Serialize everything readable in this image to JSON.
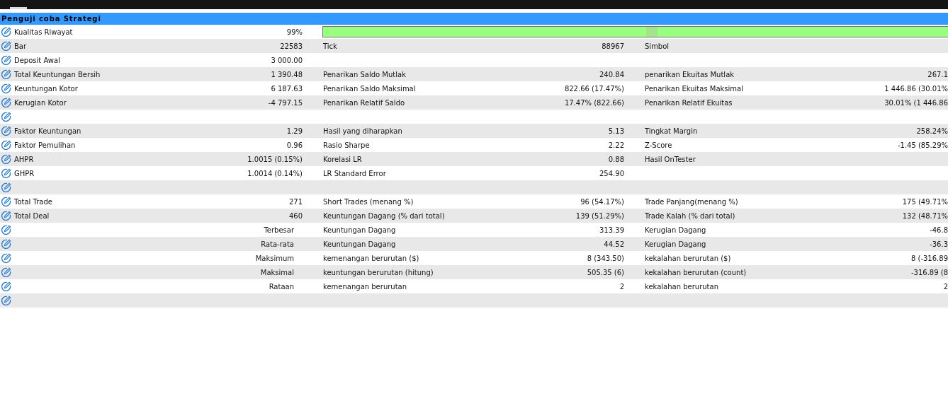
{
  "window": {
    "title": "Penguji coba Strategi"
  },
  "rows": [
    {
      "kind": "quality",
      "cells": [
        {
          "label": "Kualitas Riwayat",
          "value": "99%"
        }
      ],
      "progress": {
        "level": 1
      }
    },
    {
      "kind": "stat",
      "cells": [
        {
          "label": "Bar",
          "value": "22583"
        },
        {
          "label": "Tick",
          "value": "88967"
        },
        {
          "label": "Simbol"
        }
      ]
    },
    {
      "kind": "stat",
      "cells": [
        {
          "label": "Deposit Awal",
          "value": "3 000.00"
        }
      ]
    },
    {
      "kind": "stat",
      "cells": [
        {
          "label": "Total Keuntungan Bersih",
          "value": "1 390.48"
        },
        {
          "label": "Penarikan Saldo Mutlak",
          "value": "240.84"
        },
        {
          "label": "penarikan Ekuitas Mutlak",
          "value": "267.1"
        }
      ]
    },
    {
      "kind": "stat",
      "cells": [
        {
          "label": "Keuntungan Kotor",
          "value": "6 187.63"
        },
        {
          "label": "Penarikan Saldo Maksimal",
          "value": "822.66 (17.47%)"
        },
        {
          "label": "Penarikan Ekuitas Maksimal",
          "value": "1 446.86 (30.01%"
        }
      ]
    },
    {
      "kind": "stat",
      "cells": [
        {
          "label": "Kerugian Kotor",
          "value": "-4 797.15"
        },
        {
          "label": "Penarikan Relatif Saldo",
          "value": "17.47% (822.66)"
        },
        {
          "label": "Penarikan Relatif Ekuitas",
          "value": "30.01% (1 446.86"
        }
      ]
    },
    {
      "kind": "blank",
      "cells": []
    },
    {
      "kind": "stat",
      "cells": [
        {
          "label": "Faktor Keuntungan",
          "value": "1.29"
        },
        {
          "label": "Hasil yang diharapkan",
          "value": "5.13"
        },
        {
          "label": "Tingkat Margin",
          "value": "258.24%"
        }
      ]
    },
    {
      "kind": "stat",
      "cells": [
        {
          "label": "Faktor Pemulihan",
          "value": "0.96"
        },
        {
          "label": "Rasio Sharpe",
          "value": "2.22"
        },
        {
          "label": "Z-Score",
          "value": "-1.45 (85.29%"
        }
      ]
    },
    {
      "kind": "stat",
      "cells": [
        {
          "label": "AHPR",
          "value": "1.0015 (0.15%)"
        },
        {
          "label": "Korelasi LR",
          "value": "0.88"
        },
        {
          "label": "Hasil OnTester"
        }
      ]
    },
    {
      "kind": "stat",
      "cells": [
        {
          "label": "GHPR",
          "value": "1.0014 (0.14%)"
        },
        {
          "label": "LR Standard Error",
          "value": "254.90"
        }
      ]
    },
    {
      "kind": "blank",
      "cells": []
    },
    {
      "kind": "stat",
      "cells": [
        {
          "label": "Total Trade",
          "value": "271"
        },
        {
          "label": "Short Trades (menang %)",
          "value": "96 (54.17%)"
        },
        {
          "label": "Trade Panjang(menang %)",
          "value": "175 (49.71%"
        }
      ]
    },
    {
      "kind": "stat",
      "cells": [
        {
          "label": "Total Deal",
          "value": "460"
        },
        {
          "label": "Keuntungan Dagang (% dari total)",
          "value": "139 (51.29%)"
        },
        {
          "label": "Trade Kalah (% dari total)",
          "value": "132 (48.71%"
        }
      ]
    },
    {
      "kind": "sub",
      "cells": [
        {
          "label": "Terbesar"
        },
        {
          "label": "Keuntungan Dagang",
          "value": "313.39"
        },
        {
          "label": "Kerugian Dagang",
          "value": "-46.8"
        }
      ]
    },
    {
      "kind": "sub",
      "cells": [
        {
          "label": "Rata-rata"
        },
        {
          "label": "Keuntungan Dagang",
          "value": "44.52"
        },
        {
          "label": "Kerugian Dagang",
          "value": "-36.3"
        }
      ]
    },
    {
      "kind": "sub",
      "cells": [
        {
          "label": "Maksimum"
        },
        {
          "label": "kemenangan berurutan ($)",
          "value": "8 (343.50)"
        },
        {
          "label": "kekalahan berurutan ($)",
          "value": "8 (-316.89"
        }
      ]
    },
    {
      "kind": "sub",
      "cells": [
        {
          "label": "Maksimal"
        },
        {
          "label": "keuntungan berurutan (hitung)",
          "value": "505.35 (6)"
        },
        {
          "label": "kekalahan berurutan (count)",
          "value": "-316.89 (8"
        }
      ]
    },
    {
      "kind": "sub",
      "cells": [
        {
          "label": "Rataan"
        },
        {
          "label": "kemenangan berurutan",
          "value": "2"
        },
        {
          "label": "kekalahan berurutan",
          "value": "2"
        }
      ]
    },
    {
      "kind": "blank",
      "cells": []
    }
  ]
}
